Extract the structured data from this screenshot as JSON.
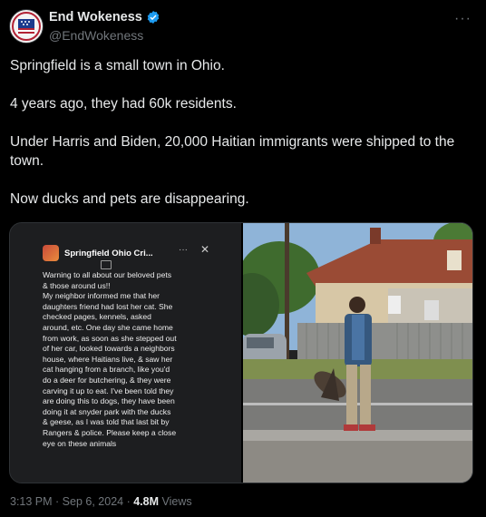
{
  "author": {
    "display_name": "End Wokeness",
    "handle": "@EndWokeness",
    "avatar_icon": "patriot-emblem-icon",
    "verified": true
  },
  "tweet": {
    "paragraphs": [
      "Springfield is a small town in Ohio.",
      "4 years ago, they had 60k residents.",
      "Under Harris and Biden, 20,000 Haitian immigrants were shipped to the town.",
      "Now ducks and pets are disappearing."
    ]
  },
  "media": {
    "screenshot_post": {
      "group_name": "Springfield Ohio Cri...",
      "menu_label": "···",
      "close_label": "✕",
      "lines": [
        "Warning to all about our beloved pets",
        "& those around us!!",
        "My neighbor informed me that her",
        "daughters friend had lost her cat. She",
        "checked pages, kennels, asked",
        "around, etc. One day she came home",
        "from work, as soon as she stepped out",
        "of her car, looked towards a neighbors",
        "house, where Haitians live, & saw her",
        "cat hanging from a branch, like you'd",
        "do a deer for butchering, & they were",
        "carving it up to eat. I've been told they",
        "are doing this to dogs, they have been",
        "doing it at snyder park with the ducks",
        "& geese, as I was told that last bit by",
        "Rangers & police. Please keep a close",
        "eye on these animals"
      ]
    }
  },
  "footer": {
    "time": "3:13 PM",
    "sep1": " · ",
    "date": "Sep 6, 2024",
    "sep2": " · ",
    "views_count": "4.8M",
    "views_label": " Views"
  },
  "colors": {
    "background": "#000000",
    "text": "#e7e9ea",
    "secondary_text": "#71767b",
    "verified_blue": "#1d9bf0"
  }
}
